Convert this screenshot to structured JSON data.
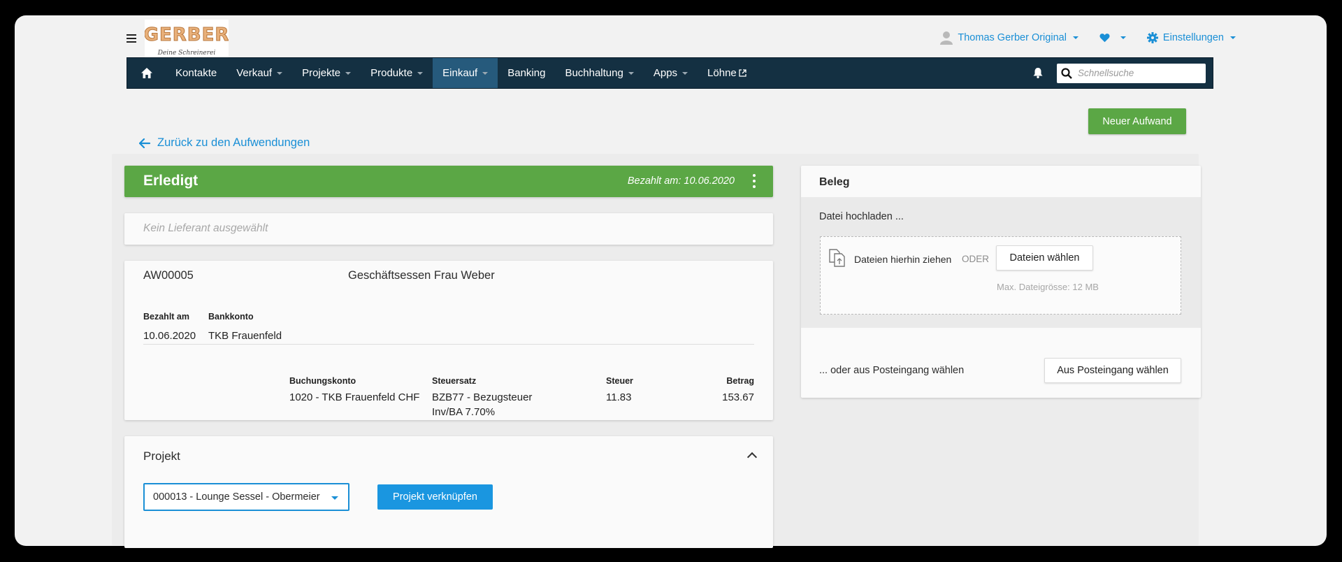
{
  "header": {
    "logo_text": "GERBER",
    "logo_subtext": "Deine Schreinerei",
    "user_name": "Thomas Gerber Original",
    "settings_label": "Einstellungen"
  },
  "nav": {
    "items": [
      {
        "label": "Kontakte",
        "dropdown": false
      },
      {
        "label": "Verkauf",
        "dropdown": true
      },
      {
        "label": "Projekte",
        "dropdown": true
      },
      {
        "label": "Produkte",
        "dropdown": true
      },
      {
        "label": "Einkauf",
        "dropdown": true,
        "active": true
      },
      {
        "label": "Banking",
        "dropdown": false
      },
      {
        "label": "Buchhaltung",
        "dropdown": true
      },
      {
        "label": "Apps",
        "dropdown": true
      },
      {
        "label": "Löhne",
        "dropdown": false,
        "external": true
      }
    ],
    "search_placeholder": "Schnellsuche"
  },
  "page": {
    "back_label": "Zurück zu den Aufwendungen",
    "new_button": "Neuer Aufwand"
  },
  "status": {
    "title": "Erledigt",
    "paid_text": "Bezahlt am: 10.06.2020"
  },
  "supplier": {
    "placeholder": "Kein Lieferant ausgewählt"
  },
  "expense": {
    "number": "AW00005",
    "description": "Geschäftsessen Frau Weber",
    "paid_on_label": "Bezahlt am",
    "paid_on_value": "10.06.2020",
    "bank_label": "Bankkonto",
    "bank_value": "TKB Frauenfeld",
    "columns": {
      "account": "Buchungskonto",
      "tax_rate": "Steuersatz",
      "tax": "Steuer",
      "amount": "Betrag"
    },
    "row": {
      "account": "1020 - TKB Frauenfeld CHF",
      "tax_rate_line1": "BZB77 - Bezugsteuer",
      "tax_rate_line2": "Inv/BA 7.70%",
      "tax": "11.83",
      "amount": "153.67"
    }
  },
  "project": {
    "title": "Projekt",
    "selected": "000013 - Lounge Sessel - Obermeier",
    "link_button": "Projekt verknüpfen"
  },
  "beleg": {
    "title": "Beleg",
    "upload_heading": "Datei hochladen ...",
    "drag_text": "Dateien hierhin ziehen",
    "or_text": "ODER",
    "choose_button": "Dateien wählen",
    "max_size": "Max. Dateigrösse: 12 MB",
    "inbox_text": "... oder aus Posteingang wählen",
    "inbox_button": "Aus Posteingang wählen"
  },
  "colors": {
    "nav_bg": "#143042",
    "nav_active": "#265a7c",
    "accent_blue": "#1a8fd6",
    "success_green": "#5ba745"
  }
}
